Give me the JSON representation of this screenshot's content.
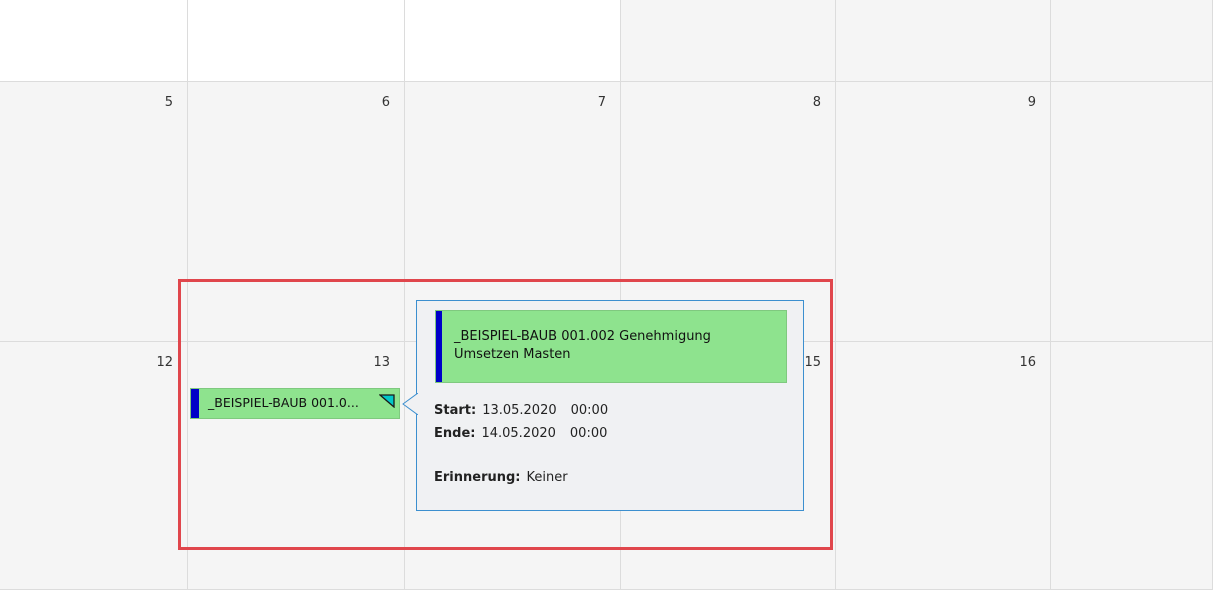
{
  "calendar": {
    "week_rows": [
      [
        "",
        "",
        "",
        "",
        "",
        ""
      ],
      [
        "5",
        "6",
        "7",
        "8",
        "9",
        ""
      ],
      [
        "12",
        "13",
        "",
        "15",
        "16",
        ""
      ]
    ]
  },
  "appointment": {
    "label": "_BEISPIEL-BAUB 001.0...",
    "color": "#8ee38e",
    "accent_color": "#0000c8"
  },
  "popup": {
    "subject_line1": "_BEISPIEL-BAUB 001.002 Genehmigung",
    "subject_line2": "Umsetzen Masten",
    "start_label": "Start:",
    "start_date": "13.05.2020",
    "start_time": "00:00",
    "end_label": "Ende:",
    "end_date": "14.05.2020",
    "end_time": "00:00",
    "reminder_label": "Erinnerung:",
    "reminder_value": "Keiner"
  },
  "colors": {
    "highlight": "#e0464c",
    "popup_border": "#3c8fcf"
  }
}
